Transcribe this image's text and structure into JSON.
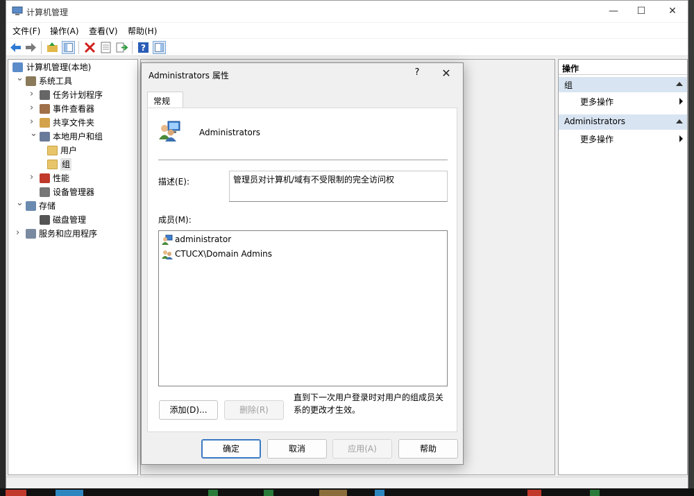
{
  "window": {
    "title": "计算机管理"
  },
  "menu": [
    "文件(F)",
    "操作(A)",
    "查看(V)",
    "帮助(H)"
  ],
  "tree": [
    {
      "label": "计算机管理(本地)",
      "level": 0,
      "expander": ""
    },
    {
      "label": "系统工具",
      "level": 1,
      "expander": "v"
    },
    {
      "label": "任务计划程序",
      "level": 2,
      "expander": ">"
    },
    {
      "label": "事件查看器",
      "level": 2,
      "expander": ">"
    },
    {
      "label": "共享文件夹",
      "level": 2,
      "expander": ">"
    },
    {
      "label": "本地用户和组",
      "level": 2,
      "expander": "v"
    },
    {
      "label": "用户",
      "level": 3,
      "expander": ""
    },
    {
      "label": "组",
      "level": 3,
      "expander": "",
      "selected": true
    },
    {
      "label": "性能",
      "level": 2,
      "expander": ">"
    },
    {
      "label": "设备管理器",
      "level": 2,
      "expander": ""
    },
    {
      "label": "存储",
      "level": 1,
      "expander": "v"
    },
    {
      "label": "磁盘管理",
      "level": 2,
      "expander": ""
    },
    {
      "label": "服务和应用程序",
      "level": 1,
      "expander": ">"
    }
  ],
  "actions": {
    "header": "操作",
    "sections": [
      {
        "title": "组",
        "item": "更多操作"
      },
      {
        "title": "Administrators",
        "item": "更多操作"
      }
    ]
  },
  "dialog": {
    "title": "Administrators 属性",
    "help": "?",
    "tab": "常规",
    "group_name": "Administrators",
    "desc_label": "描述(E):",
    "desc_value": "管理员对计算机/域有不受限制的完全访问权",
    "members_label": "成员(M):",
    "members": [
      {
        "name": "administrator",
        "icon": "user-icon"
      },
      {
        "name": "CTUCX\\Domain Admins",
        "icon": "group-icon"
      }
    ],
    "add_button": "添加(D)...",
    "remove_button": "删除(R)",
    "note": "直到下一次用户登录时对用户的组成员关系的更改才生效。",
    "ok_button": "确定",
    "cancel_button": "取消",
    "apply_button": "应用(A)",
    "help_button": "帮助"
  },
  "colors": {
    "accent": "#3a78c4",
    "action_section": "#d8e4f1"
  }
}
